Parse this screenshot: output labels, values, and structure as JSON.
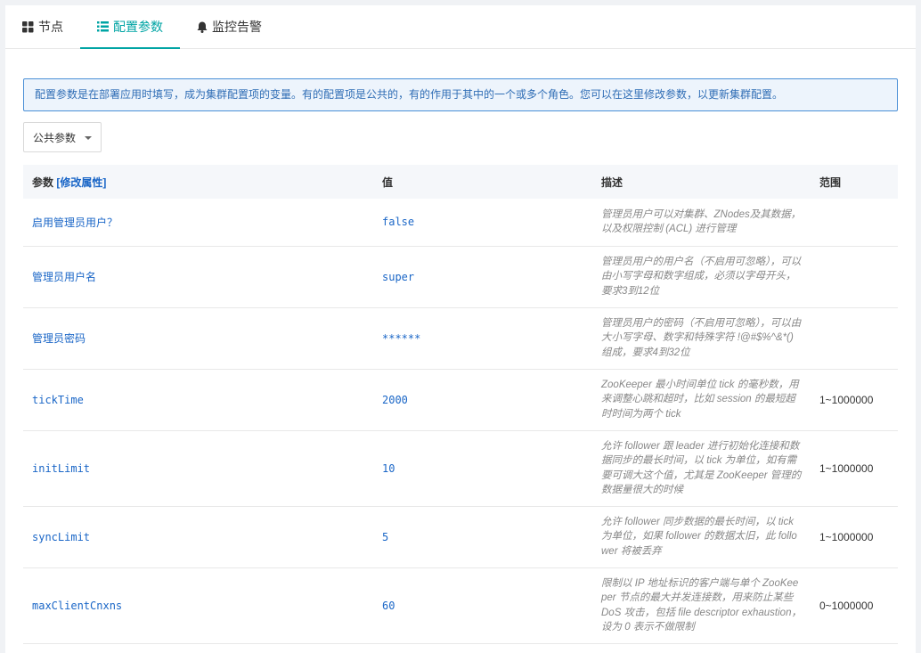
{
  "tabs": [
    {
      "label": "节点",
      "icon": "grid-icon"
    },
    {
      "label": "配置参数",
      "icon": "list-icon",
      "active": true
    },
    {
      "label": "监控告警",
      "icon": "bell-icon"
    }
  ],
  "info_text": "配置参数是在部署应用时填写，成为集群配置项的变量。有的配置项是公共的，有的作用于其中的一个或多个角色。您可以在这里修改参数，以更新集群配置。",
  "param_select": {
    "value": "公共参数"
  },
  "table": {
    "headers": {
      "param": "参数",
      "modify_link": "[修改属性]",
      "value": "值",
      "desc": "描述",
      "range": "范围"
    },
    "rows": [
      {
        "name": "启用管理员用户？",
        "value": "false",
        "desc": "管理员用户可以对集群、ZNodes及其数据，以及权限控制 (ACL) 进行管理",
        "range": ""
      },
      {
        "name": "管理员用户名",
        "value": "super",
        "desc": "管理员用户的用户名（不启用可忽略），可以由小写字母和数字组成，必须以字母开头，要求3到12位",
        "range": ""
      },
      {
        "name": "管理员密码",
        "value": "******",
        "desc": "管理员用户的密码（不启用可忽略），可以由大小写字母、数字和特殊字符 !@#$%^&*() 组成，要求4到32位",
        "range": ""
      },
      {
        "name": "tickTime",
        "value": "2000",
        "desc": "ZooKeeper 最小时间单位 tick 的毫秒数，用来调整心跳和超时，比如 session 的最短超时时间为两个 tick",
        "range": "1~1000000"
      },
      {
        "name": "initLimit",
        "value": "10",
        "desc": "允许 follower 跟 leader 进行初始化连接和数据同步的最长时间，以 tick 为单位，如有需要可调大这个值，尤其是 ZooKeeper 管理的数据量很大的时候",
        "range": "1~1000000"
      },
      {
        "name": "syncLimit",
        "value": "5",
        "desc": "允许 follower 同步数据的最长时间，以 tick 为单位，如果 follower 的数据太旧，此 follower 将被丢弃",
        "range": "1~1000000"
      },
      {
        "name": "maxClientCnxns",
        "value": "60",
        "desc": "限制以 IP 地址标识的客户端与单个 ZooKeeper 节点的最大并发连接数，用来防止某些 DoS 攻击，包括 file descriptor exhaustion，设为 0 表示不做限制",
        "range": "0~1000000"
      }
    ]
  },
  "colors": {
    "accent": "#00a4a4",
    "link": "#1a66c7",
    "info_border": "#4a8fd6"
  }
}
